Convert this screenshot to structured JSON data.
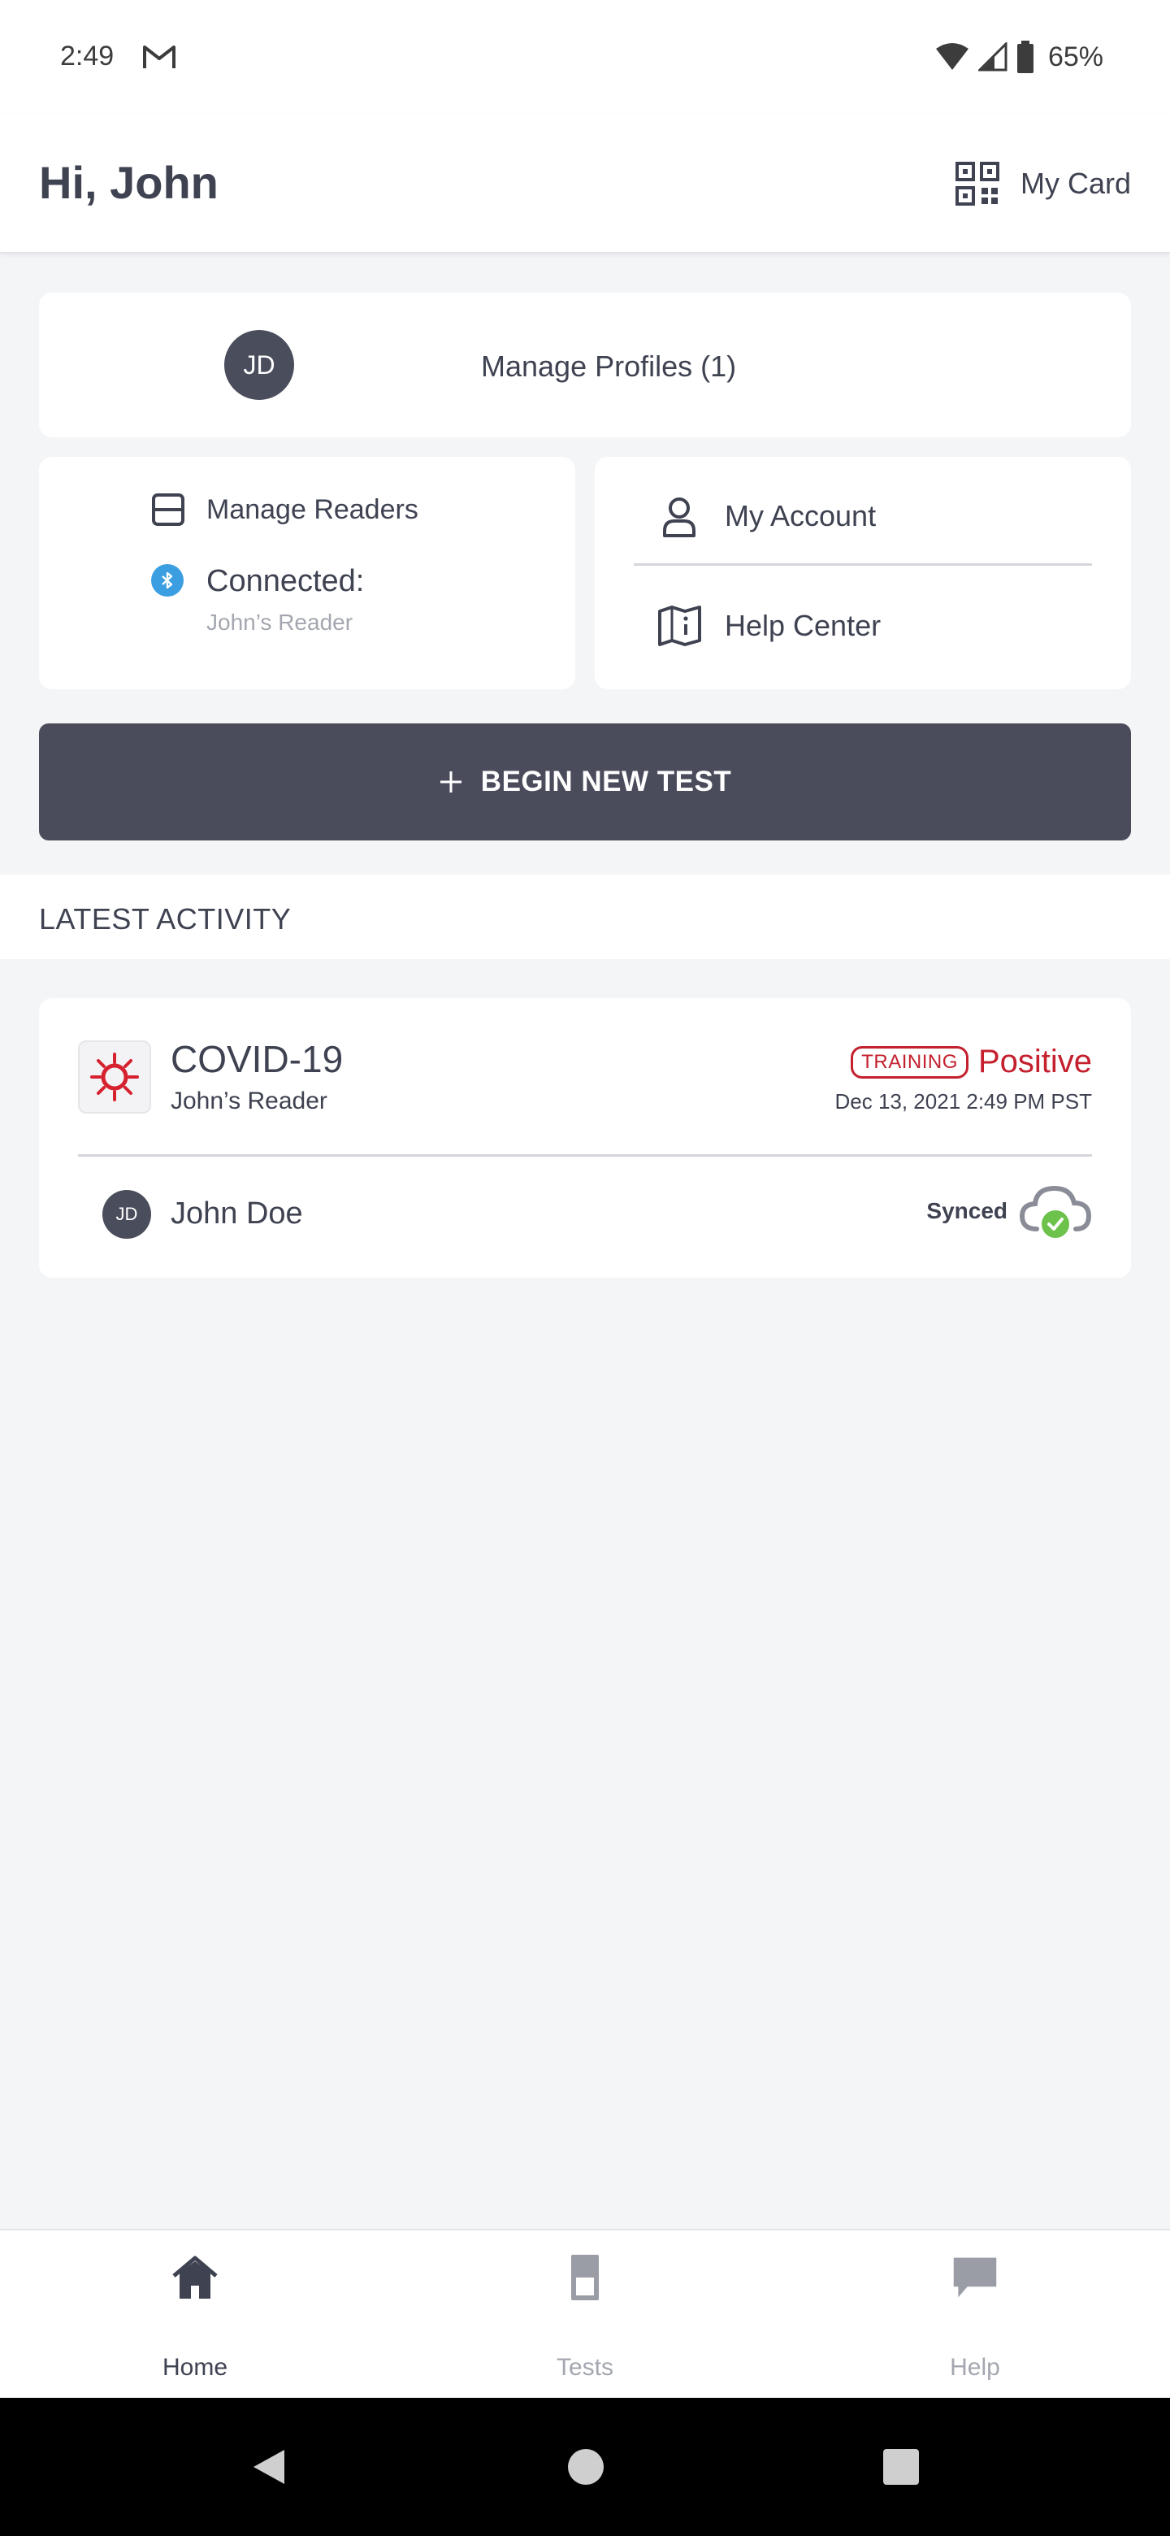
{
  "status_bar": {
    "time": "2:49",
    "battery": "65%",
    "icons": [
      "gmail-icon",
      "wifi-icon",
      "signal-icon",
      "battery-icon"
    ]
  },
  "header": {
    "greeting": "Hi, John",
    "my_card_label": "My Card",
    "my_card_icon": "qr-code-icon"
  },
  "profiles": {
    "avatar_initials": "JD",
    "label": "Manage Profiles (1)"
  },
  "readers": {
    "manage_label": "Manage Readers",
    "connected_label": "Connected:",
    "connected_reader": "John’s Reader"
  },
  "account_menu": {
    "my_account_label": "My Account",
    "help_center_label": "Help Center"
  },
  "begin_test": {
    "label": "BEGIN NEW TEST",
    "icon": "plus-icon"
  },
  "latest_activity": {
    "title": "LATEST ACTIVITY",
    "item": {
      "test_name": "COVID-19",
      "reader": "John’s Reader",
      "badge": "TRAINING",
      "result": "Positive",
      "date": "Dec 13, 2021 2:49 PM PST",
      "patient_initials": "JD",
      "patient_name": "John Doe",
      "sync_status": "Synced"
    }
  },
  "bottom_nav": {
    "items": [
      {
        "label": "Home",
        "icon": "home-icon",
        "active": true
      },
      {
        "label": "Tests",
        "icon": "test-strip-icon",
        "active": false
      },
      {
        "label": "Help",
        "icon": "chat-bubble-icon",
        "active": false
      }
    ]
  },
  "colors": {
    "primary_dark": "#4a4c5c",
    "result_red": "#c4202e",
    "bluetooth_blue": "#3b9ee0",
    "synced_green": "#6cc24a",
    "background": "#f4f5f7"
  }
}
